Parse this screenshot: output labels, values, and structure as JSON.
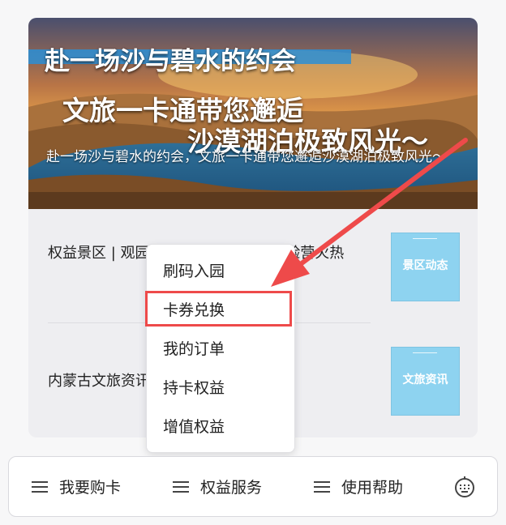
{
  "banner": {
    "line1": "赴一场沙与碧水的约会",
    "line2": "文旅一卡通带您邂逅",
    "line3": "沙漠湖泊极致风光～",
    "description": "赴一场沙与碧水的约会，文旅一卡通带您邂逅沙漠湖泊极致风光～"
  },
  "list": {
    "items": [
      {
        "text": "权益景区 | 观园遇兰台·青少年龙舟体验营火热",
        "thumb_label": "景区动态"
      },
      {
        "text": "内蒙古文旅资讯",
        "thumb_label": "文旅资讯"
      }
    ]
  },
  "menu": {
    "items": [
      {
        "label": "刷码入园"
      },
      {
        "label": "卡券兑换"
      },
      {
        "label": "我的订单"
      },
      {
        "label": "持卡权益"
      },
      {
        "label": "增值权益"
      }
    ],
    "highlighted_index": 1
  },
  "bottom_nav": {
    "tabs": [
      {
        "label": "我要购卡"
      },
      {
        "label": "权益服务"
      },
      {
        "label": "使用帮助"
      }
    ],
    "keyboard_icon": "keyboard-icon"
  },
  "colors": {
    "highlight": "#ee4a4a",
    "arrow": "#ee4a4a",
    "thumb": "#8ed3f0",
    "title_bar": "#2b8fd6"
  }
}
